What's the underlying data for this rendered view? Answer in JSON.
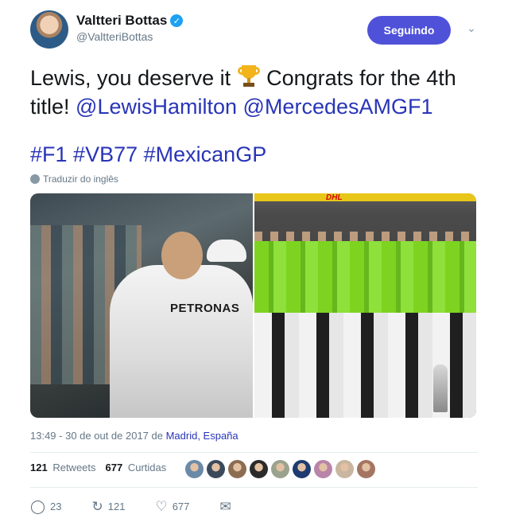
{
  "user": {
    "display_name": "Valtteri Bottas",
    "handle": "@ValtteriBottas",
    "verified_icon": "✓"
  },
  "follow_button": {
    "label": "Seguindo"
  },
  "menu_icon": "⌄",
  "tweet": {
    "text_before_emoji": "Lewis, you deserve it ",
    "emoji": "trophy-emoji",
    "text_after_emoji": " Congrats for the 4th title! ",
    "mention_1": "@LewisHamilton",
    "mention_2": "@MercedesAMGF1",
    "hashtags": [
      "#F1",
      "#VB77",
      "#MexicanGP"
    ]
  },
  "translate": {
    "label": "Traduzir do inglês"
  },
  "media": {
    "left_logo_text": "PETRONAS",
    "right_banner_text": "DHL"
  },
  "meta": {
    "timestamp": "13:49 - 30 de out de 2017 de ",
    "location": "Madrid, España"
  },
  "stats": {
    "retweets_count": "121",
    "retweets_label": "Retweets",
    "likes_count": "677",
    "likes_label": "Curtidas",
    "liker_avatar_colors": [
      "#6a8aa8",
      "#3b4a5a",
      "#8c6d52",
      "#2b2b2b",
      "#9aa38e",
      "#1d3b6f",
      "#b884a8",
      "#c9b6a0",
      "#a47562"
    ]
  },
  "actions": {
    "reply_icon": "◯",
    "reply_count": "23",
    "retweet_icon": "↻",
    "retweet_count": "121",
    "like_icon": "♡",
    "like_count": "677",
    "dm_icon": "✉"
  }
}
